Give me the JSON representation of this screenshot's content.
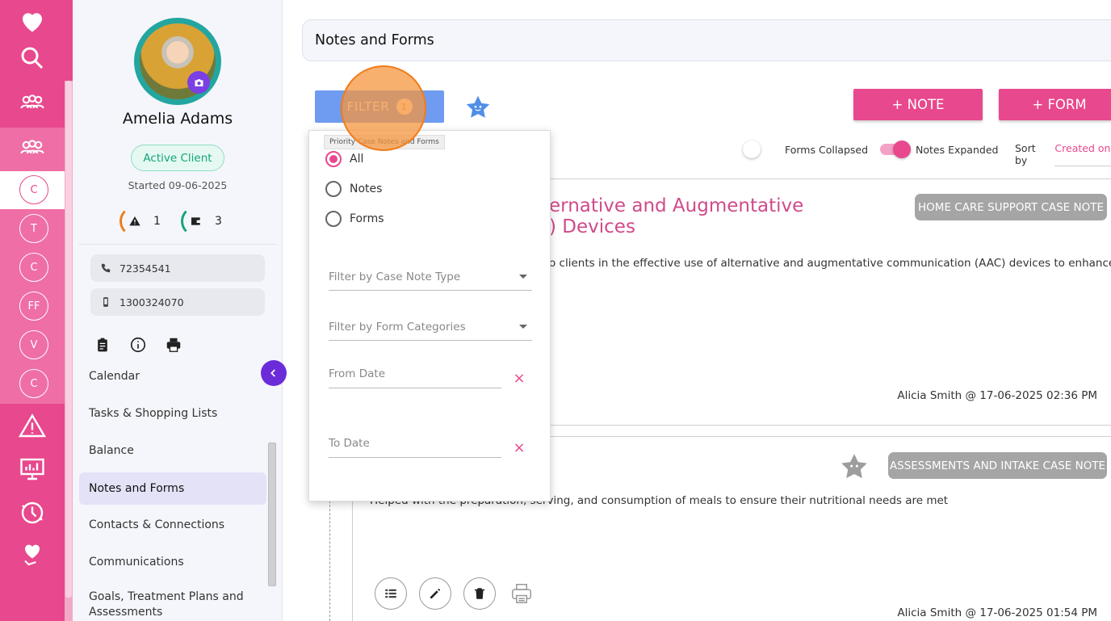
{
  "rail": {
    "circles": [
      "C",
      "T",
      "C",
      "FF",
      "V",
      "C"
    ]
  },
  "profile": {
    "name": "Amelia Adams",
    "status": "Active Client",
    "started": "Started 09-06-2025",
    "alerts_count": "1",
    "wallet_count": "3",
    "phone": "72354541",
    "mobile": "1300324070",
    "nav": [
      "Calendar",
      "Tasks & Shopping Lists",
      "Balance",
      "Notes and Forms",
      "Contacts & Connections",
      "Communications",
      "Goals, Treatment Plans and Assessments"
    ]
  },
  "main": {
    "title": "Notes and Forms",
    "filter_label": "FILTER",
    "filter_count": "1",
    "add_note": "+ NOTE",
    "add_form": "+ FORM",
    "forms_toggle": "Forms Collapsed",
    "notes_toggle": "Notes Expanded",
    "sort_label": "Sort by",
    "sort_value": "Created on"
  },
  "filter_panel": {
    "tooltip": "Priority Case Notes and Forms",
    "options": [
      "All",
      "Notes",
      "Forms"
    ],
    "selected": "All",
    "case_note_type_placeholder": "Filter by Case Note Type",
    "form_categories_placeholder": "Filter by Form Categories",
    "from_date_placeholder": "From Date",
    "to_date_placeholder": "To Date"
  },
  "notes": [
    {
      "title_visible": "ernative and Augmentative\n) Devices",
      "tag": "HOME CARE SUPPORT CASE NOTE",
      "body_visible": "o clients in the effective use of alternative and augmentative communication (AAC) devices to enhance",
      "author": "Alicia Smith @ 17-06-2025 02:36 PM"
    },
    {
      "tag": "ASSESSMENTS AND INTAKE CASE NOTE",
      "body_visible": "Helped with the preparation, serving, and consumption of meals to ensure their nutritional needs are met",
      "author": "Alicia Smith @ 17-06-2025 01:54 PM"
    }
  ],
  "colors": {
    "brand_pink": "#e8488d",
    "filter_blue": "#6f9cf0",
    "active_green": "#14a47c",
    "purple": "#6c2bd9",
    "highlight_orange": "#f07c1a"
  }
}
